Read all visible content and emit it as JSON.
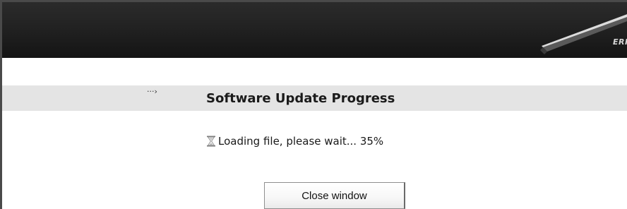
{
  "header": {
    "logo_text": "ERIC"
  },
  "page": {
    "title_arrow": "···›",
    "title": "Software Update Progress"
  },
  "status": {
    "icon": "hourglass-icon",
    "message": "Loading file, please wait... 35%",
    "progress_percent": 35
  },
  "actions": {
    "close_label": "Close window"
  },
  "colors": {
    "header_bg": "#1f1f1f",
    "title_band_bg": "#e4e4e4",
    "page_bg": "#ffffff"
  }
}
